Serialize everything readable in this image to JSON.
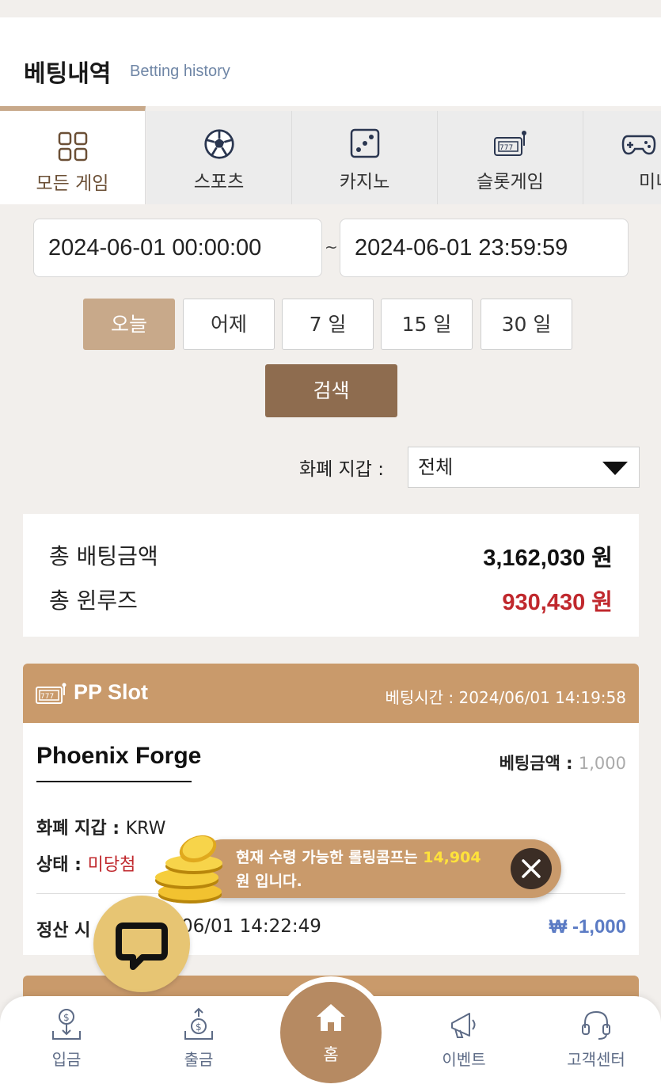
{
  "header": {
    "title": "베팅내역",
    "subtitle": "Betting history"
  },
  "tabs": [
    {
      "label": "모든 게임",
      "icon": "grid-icon",
      "active": true
    },
    {
      "label": "스포츠",
      "icon": "soccer-ball-icon",
      "active": false
    },
    {
      "label": "카지노",
      "icon": "dice-icon",
      "active": false
    },
    {
      "label": "슬롯게임",
      "icon": "slot-machine-icon",
      "active": false
    },
    {
      "label": "미니",
      "icon": "gamepad-icon",
      "active": false
    }
  ],
  "date_range": {
    "start": "2024-06-01 00:00:00",
    "separator": "~",
    "end": "2024-06-01 23:59:59"
  },
  "quick_ranges": [
    {
      "label": "오늘",
      "active": true
    },
    {
      "label": "어제",
      "active": false
    },
    {
      "label": "7 일",
      "active": false
    },
    {
      "label": "15 일",
      "active": false
    },
    {
      "label": "30 일",
      "active": false
    }
  ],
  "search_label": "검색",
  "wallet_filter": {
    "label": "화폐 지갑 :",
    "selected": "전체"
  },
  "summary": {
    "total_bet_label": "총 배팅금액",
    "total_bet_value": "3,162,030 원",
    "total_winloss_label": "총 윈루즈",
    "total_winloss_value": "930,430 원"
  },
  "bet_card": {
    "provider": "PP Slot",
    "bet_time_label": "베팅시간 :",
    "bet_time": "2024/06/01 14:19:58",
    "game_name": "Phoenix Forge",
    "bet_amount_label": "베팅금액 :",
    "bet_amount": "1,000",
    "wallet_label": "화폐 지갑 :",
    "wallet_value": "KRW",
    "status_label": "상태 :",
    "status_value": "미당첨",
    "settle_label": "정산 시",
    "settle_time": "06/01 14:22:49",
    "settle_amount": "₩ -1,000"
  },
  "toast": {
    "prefix": "현재 수령 가능한 롤링콤프는",
    "amount": "14,904",
    "suffix": "원 입니다."
  },
  "bottom_nav": {
    "deposit": "입금",
    "withdraw": "출금",
    "home": "홈",
    "event": "이벤트",
    "support": "고객센터"
  },
  "colors": {
    "accent": "#c99a6b",
    "dark_accent": "#8e6c4f",
    "active_quick": "#c8a98a",
    "winloss": "#c0282d",
    "settle": "#5b7bc4",
    "toast_highlight": "#ffe23b"
  }
}
